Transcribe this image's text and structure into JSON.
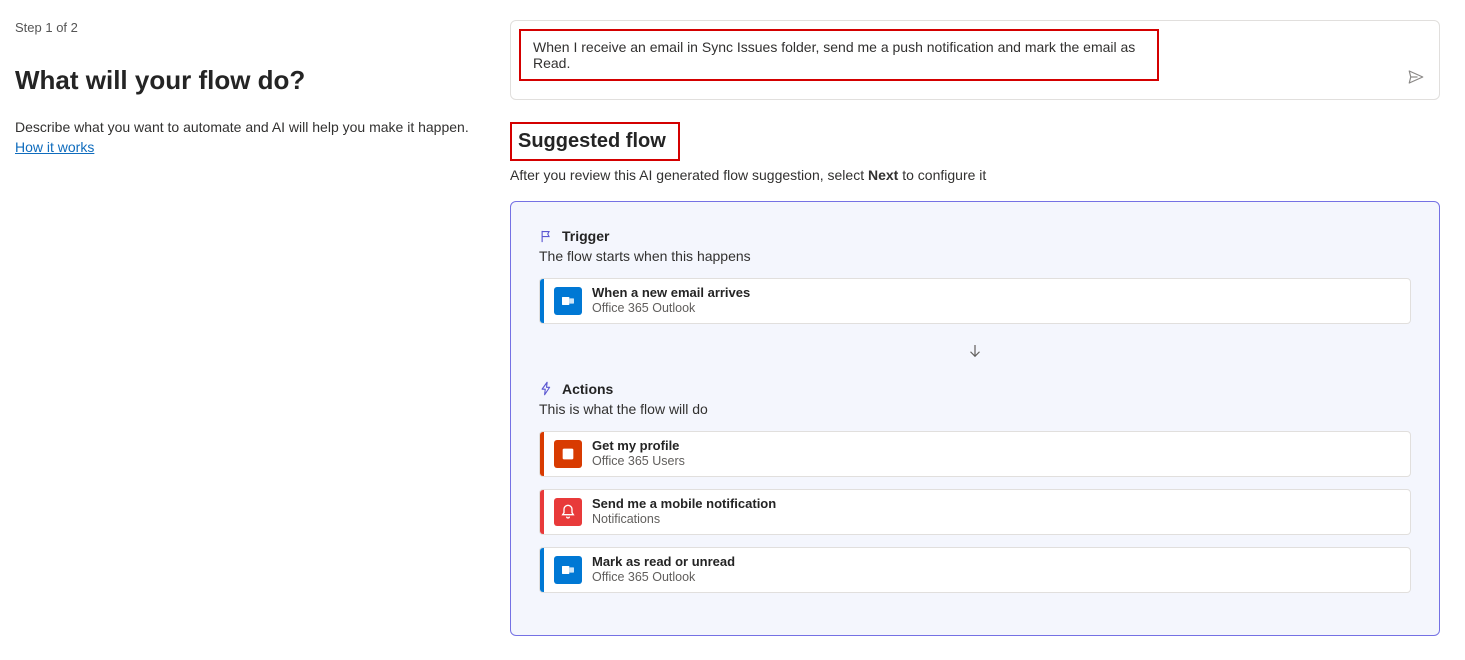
{
  "left": {
    "step": "Step 1 of 2",
    "title": "What will your flow do?",
    "desc": "Describe what you want to automate and AI will help you make it happen.",
    "how_link": "How it works"
  },
  "prompt": {
    "text": "When I receive an email in Sync Issues folder, send me a push notification and mark the email as Read."
  },
  "suggested": {
    "title": "Suggested flow",
    "sub_pre": "After you review this AI generated flow suggestion, select ",
    "sub_bold": "Next",
    "sub_post": " to configure it"
  },
  "trigger": {
    "heading": "Trigger",
    "sub": "The flow starts when this happens",
    "card": {
      "title": "When a new email arrives",
      "connector": "Office 365 Outlook",
      "accent": "blue",
      "icon": "outlook"
    }
  },
  "actions": {
    "heading": "Actions",
    "sub": "This is what the flow will do",
    "items": [
      {
        "title": "Get my profile",
        "connector": "Office 365 Users",
        "accent": "orange",
        "icon": "office"
      },
      {
        "title": "Send me a mobile notification",
        "connector": "Notifications",
        "accent": "red",
        "icon": "notif"
      },
      {
        "title": "Mark as read or unread",
        "connector": "Office 365 Outlook",
        "accent": "blue",
        "icon": "outlook"
      }
    ]
  }
}
